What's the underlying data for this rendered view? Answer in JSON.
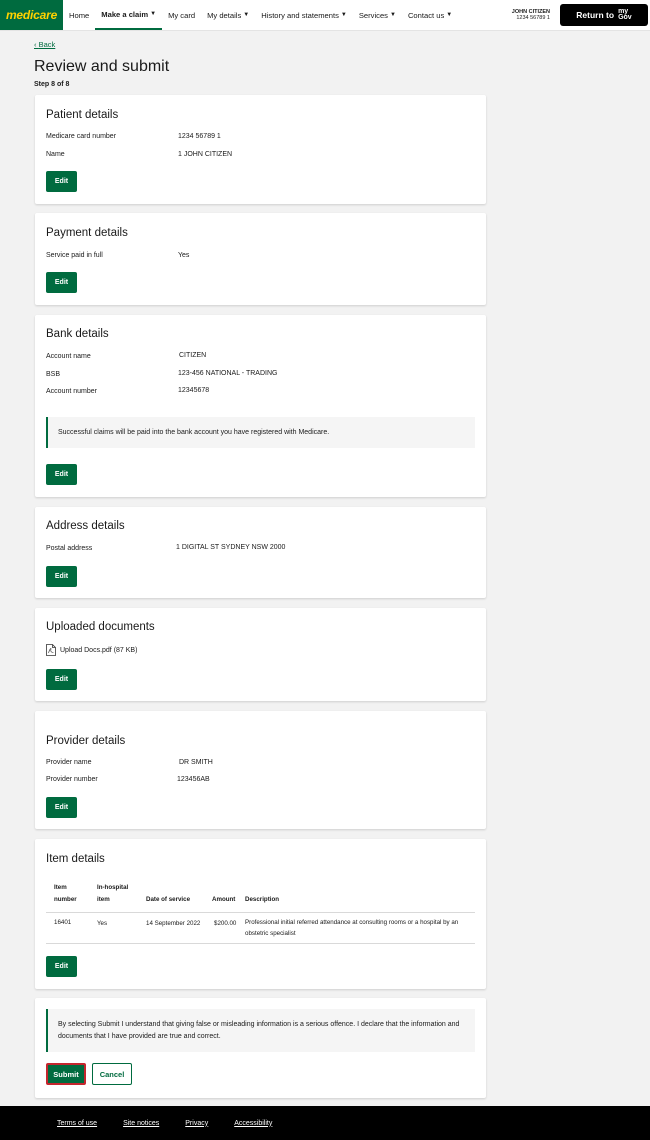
{
  "header": {
    "logo": "medicare",
    "nav": [
      {
        "label": "Home",
        "dropdown": false
      },
      {
        "label": "Make a claim",
        "dropdown": true,
        "active": true
      },
      {
        "label": "My card",
        "dropdown": false
      },
      {
        "label": "My details",
        "dropdown": true
      },
      {
        "label": "History and statements",
        "dropdown": true
      },
      {
        "label": "Services",
        "dropdown": true
      },
      {
        "label": "Contact us",
        "dropdown": true
      }
    ],
    "user_name": "JOHN CITIZEN",
    "user_number": "1234 56789 1",
    "return_label": "Return to",
    "mygov_top": "my",
    "mygov_bottom": "Gov"
  },
  "page": {
    "back_label": "Back",
    "title": "Review and submit",
    "step": "Step 8 of 8"
  },
  "patient": {
    "heading": "Patient details",
    "card_label": "Medicare card number",
    "card_value": "1234 56789 1",
    "name_label": "Name",
    "name_value": "1 JOHN CITIZEN",
    "edit": "Edit"
  },
  "payment": {
    "heading": "Payment details",
    "paid_label": "Service paid in full",
    "paid_value": "Yes",
    "edit": "Edit"
  },
  "bank": {
    "heading": "Bank details",
    "acc_name_label": "Account name",
    "acc_name_value": "CITIZEN",
    "bsb_label": "BSB",
    "bsb_value": "123-456 NATIONAL - TRADING",
    "acc_num_label": "Account number",
    "acc_num_value": "12345678",
    "notice": "Successful claims will be paid into the bank account you have registered with Medicare.",
    "edit": "Edit"
  },
  "address": {
    "heading": "Address details",
    "postal_label": "Postal address",
    "postal_value": "1 DIGITAL ST SYDNEY NSW 2000",
    "edit": "Edit"
  },
  "documents": {
    "heading": "Uploaded documents",
    "file": "Upload Docs.pdf (87 KB)",
    "edit": "Edit"
  },
  "provider": {
    "heading": "Provider details",
    "name_label": "Provider name",
    "name_value": "DR SMITH",
    "number_label": "Provider number",
    "number_value": "123456AB",
    "edit": "Edit"
  },
  "items": {
    "heading": "Item details",
    "columns": [
      "Item number",
      "In-hospital item",
      "Date of service",
      "Amount",
      "Description"
    ],
    "rows": [
      {
        "item_number": "16401",
        "in_hospital": "Yes",
        "date": "14 September 2022",
        "amount": "$200.00",
        "description": "Professional initial referred attendance at consulting rooms or a hospital by an obstetric specialist"
      }
    ],
    "edit": "Edit"
  },
  "declaration": {
    "text": "By selecting Submit I understand that giving false or misleading information is a serious offence. I declare that the information and documents that I have provided are true and correct.",
    "submit": "Submit",
    "cancel": "Cancel"
  },
  "footer": {
    "links": [
      "Terms of use",
      "Site notices",
      "Privacy",
      "Accessibility"
    ]
  },
  "colors": {
    "brand_green": "#006b3f",
    "logo_yellow": "#ffd200",
    "submit_focus": "#c4262e"
  }
}
